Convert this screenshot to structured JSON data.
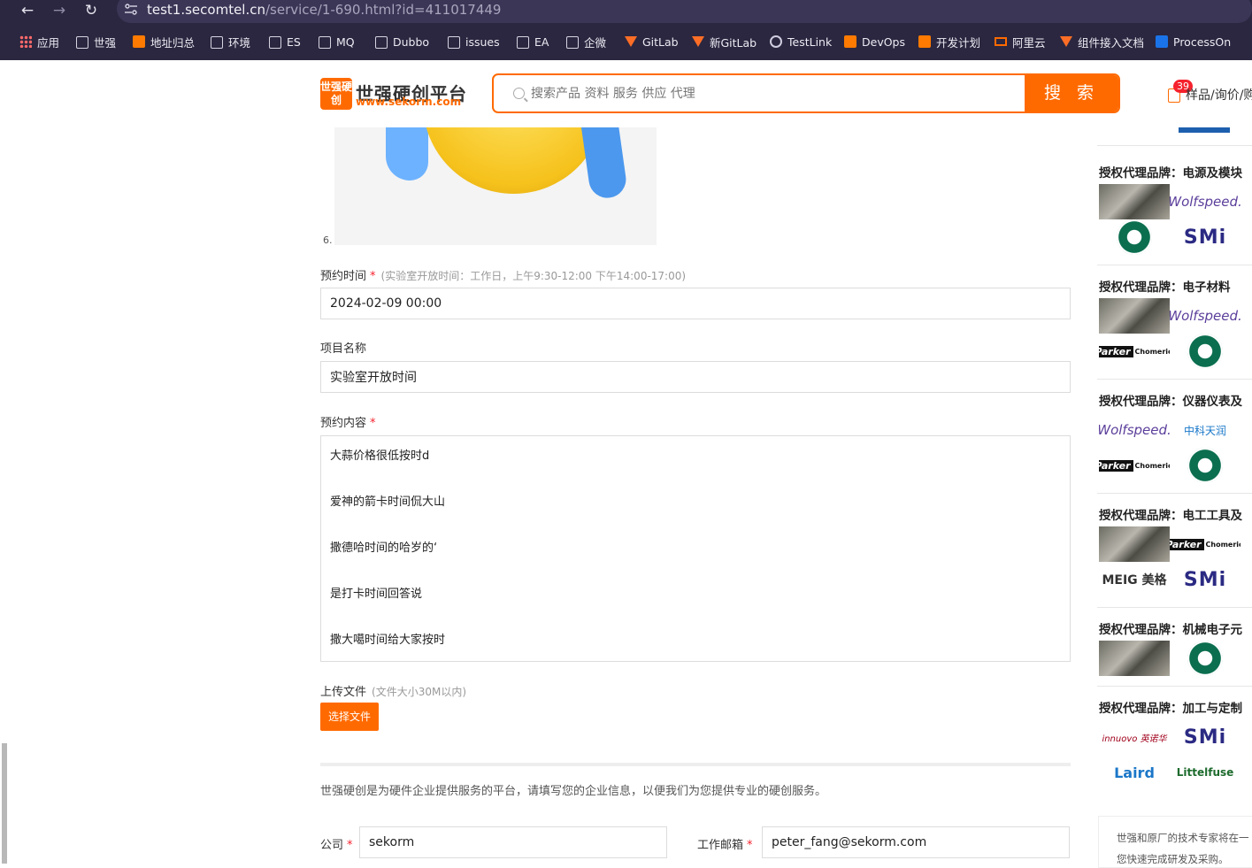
{
  "browser": {
    "url_host": "test1.secomtel.cn",
    "url_path": "/service/1-690.html?id=411017449",
    "bookmarks": [
      {
        "label": "应用",
        "icon": "apps-grid-icon"
      },
      {
        "label": "世强",
        "icon": "folder-icon"
      },
      {
        "label": "地址归总",
        "icon": "sekorm-icon"
      },
      {
        "label": "环境",
        "icon": "folder-icon"
      },
      {
        "label": "ES",
        "icon": "folder-icon"
      },
      {
        "label": "MQ",
        "icon": "folder-icon"
      },
      {
        "label": "Dubbo",
        "icon": "folder-icon"
      },
      {
        "label": "issues",
        "icon": "folder-icon"
      },
      {
        "label": "EA",
        "icon": "folder-icon"
      },
      {
        "label": "企微",
        "icon": "folder-icon"
      },
      {
        "label": "GitLab",
        "icon": "gitlab-icon"
      },
      {
        "label": "新GitLab",
        "icon": "gitlab-icon"
      },
      {
        "label": "TestLink",
        "icon": "globe-icon"
      },
      {
        "label": "DevOps",
        "icon": "sekorm-icon"
      },
      {
        "label": "开发计划",
        "icon": "sekorm-icon"
      },
      {
        "label": "阿里云",
        "icon": "aliyun-icon"
      },
      {
        "label": "组件接入文档",
        "icon": "gitlab-icon"
      },
      {
        "label": "ProcessOn",
        "icon": "processon-icon"
      }
    ]
  },
  "header": {
    "logo_mark": "世强硬创",
    "logo_title": "世强硬创平台",
    "logo_url": "www.sekorm.com",
    "search_placeholder": "搜索产品 资料 服务 供应 代理",
    "search_button": "搜 索",
    "cart_count": "39",
    "cart_text": "样品/询价/购"
  },
  "form": {
    "list_number": "6.",
    "time_label": "预约时间",
    "time_hint": "(实验室开放时间：工作日，上午9:30-12:00 下午14:00-17:00)",
    "time_value": "2024-02-09 00:00",
    "project_label": "项目名称",
    "project_value": "实验室开放时间",
    "content_label": "预约内容",
    "content_lines": [
      "大蒜价格很低按时d",
      "爱神的箭卡时间侃大山",
      "撒德哈时间的哈岁的‘",
      "是打卡时间回答说",
      "撒大噶时间给大家按时"
    ],
    "upload_label": "上传文件",
    "upload_hint": "(文件大小30M以内)",
    "upload_button": "选择文件",
    "intro_text": "世强硬创是为硬件企业提供服务的平台，请填写您的企业信息，以便我们为您提供专业的硬创服务。",
    "company_label": "公司",
    "company_value": "sekorm",
    "email_label": "工作邮箱",
    "email_value": "peter_fang@sekorm.com",
    "required_mark": "*"
  },
  "sidebar": {
    "sections": [
      {
        "title": "授权代理品牌：电源及模块"
      },
      {
        "title": "授权代理品牌：电子材料"
      },
      {
        "title": "授权代理品牌：仪器仪表及"
      },
      {
        "title": "授权代理品牌：电工工具及"
      },
      {
        "title": "授权代理品牌：机械电子元"
      },
      {
        "title": "授权代理品牌：加工与定制"
      }
    ],
    "brands": {
      "wolfspeed": "Wolfspeed.",
      "smi": "SMi",
      "parker": "Parker",
      "chomerics": "Chomerics",
      "meig": "MEIG 美格",
      "laird": "Laird",
      "littelfuse": "Littelfuse",
      "innuovo": "innuovo 英诺华",
      "zhongke": "中科天润"
    },
    "footer_line1": "世强和原厂的技术专家将在一",
    "footer_line2": "您快速完成研发及采购。"
  }
}
